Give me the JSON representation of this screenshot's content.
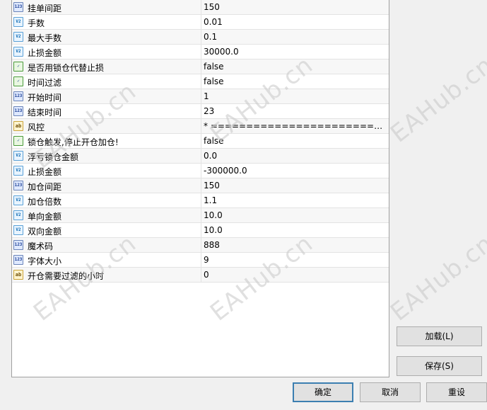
{
  "parameters": [
    {
      "name": "挂单间距",
      "value": "150",
      "type": "int"
    },
    {
      "name": "手数",
      "value": "0.01",
      "type": "dbl"
    },
    {
      "name": "最大手数",
      "value": "0.1",
      "type": "dbl"
    },
    {
      "name": "止损金额",
      "value": "30000.0",
      "type": "dbl"
    },
    {
      "name": "是否用锁仓代替止损",
      "value": "false",
      "type": "bool"
    },
    {
      "name": "时间过滤",
      "value": "false",
      "type": "bool"
    },
    {
      "name": "开始时间",
      "value": "1",
      "type": "int"
    },
    {
      "name": "结束时间",
      "value": "23",
      "type": "int"
    },
    {
      "name": "风控",
      "value": "* ======================================",
      "type": "str"
    },
    {
      "name": "锁仓触发,停止开仓加仓!",
      "value": "false",
      "type": "bool"
    },
    {
      "name": "浮亏锁仓金额",
      "value": "0.0",
      "type": "dbl"
    },
    {
      "name": "止损金额",
      "value": "-300000.0",
      "type": "dbl"
    },
    {
      "name": "加仓间距",
      "value": "150",
      "type": "int"
    },
    {
      "name": "加仓倍数",
      "value": "1.1",
      "type": "dbl"
    },
    {
      "name": "单向金额",
      "value": "10.0",
      "type": "dbl"
    },
    {
      "name": "双向金额",
      "value": "10.0",
      "type": "dbl"
    },
    {
      "name": "魔术码",
      "value": "888",
      "type": "int"
    },
    {
      "name": "字体大小",
      "value": "9",
      "type": "int"
    },
    {
      "name": "开仓需要过滤的小时",
      "value": "0",
      "type": "str"
    }
  ],
  "icon_glyphs": {
    "int": "123",
    "dbl": "V2",
    "bool": "✓",
    "str": "ab"
  },
  "watermark_text": "EAHub.cn",
  "buttons": {
    "load": "加载(L)",
    "save": "保存(S)",
    "ok": "确定",
    "cancel": "取消",
    "reset": "重设"
  }
}
